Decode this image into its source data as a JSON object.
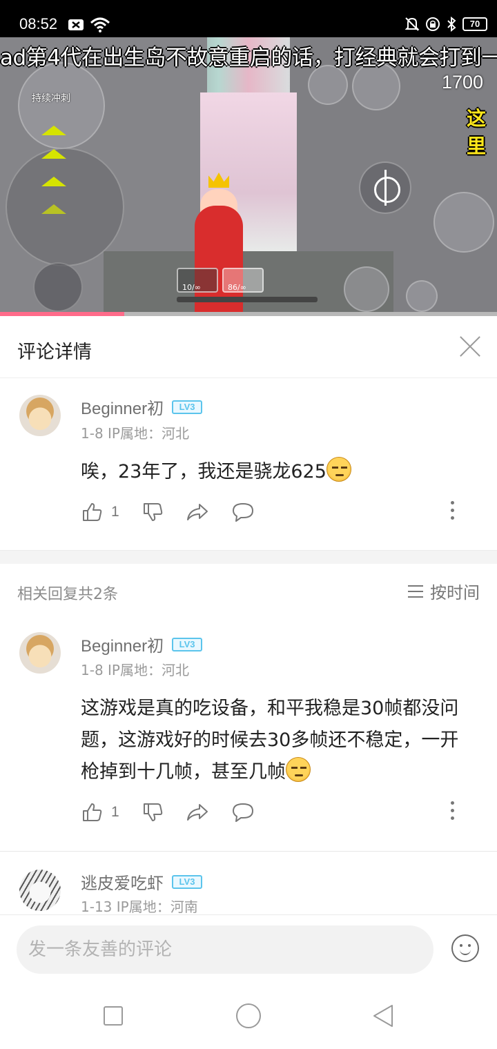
{
  "status_bar": {
    "time": "08:52",
    "battery": "70",
    "left_icons": [
      "notification-x-icon",
      "wifi-icon"
    ],
    "right_icons": [
      "mute-bell-icon",
      "alarm-lock-icon",
      "bluetooth-icon",
      "battery-icon"
    ]
  },
  "video": {
    "subtitle": "ad第4代在出生岛不故意重启的话，打经典就会打到一",
    "hud": {
      "dash_label": "持续冲刺",
      "score": "1700",
      "callout": "这里",
      "weapon_slot_1": "10/∞",
      "weapon_slot_2": "86/∞"
    },
    "progress_fraction": 0.25
  },
  "detail_header": {
    "title": "评论详情",
    "close_icon": "close-icon"
  },
  "main_comment": {
    "username": "Beginner初",
    "level": "LV3",
    "meta": "1-8  IP属地：河北",
    "text": "唉，23年了，我还是骁龙625",
    "emoji": "pensive-emoji",
    "like_count": "1"
  },
  "replies_header": {
    "count_label": "相关回复共2条",
    "sort_label": "按时间"
  },
  "replies": [
    {
      "username": "Beginner初",
      "level": "LV3",
      "meta": "1-8  IP属地：河北",
      "text": "这游戏是真的吃设备，和平我稳是30帧都没问题，这游戏好的时候去30多帧还不稳定，一开枪掉到十几帧，甚至几帧",
      "emoji": "annoyed-emoji",
      "like_count": "1"
    },
    {
      "username": "逃皮爱吃虾",
      "level": "LV3",
      "meta": "1-13  IP属地：河南"
    }
  ],
  "input": {
    "placeholder": "发一条友善的评论"
  },
  "colors": {
    "level_badge": "#5bc4ec",
    "text_primary": "#222222",
    "text_secondary": "#707070",
    "text_meta": "#9a9a9a",
    "input_bg": "#f2f2f2",
    "progress": "#ff6b8a"
  }
}
